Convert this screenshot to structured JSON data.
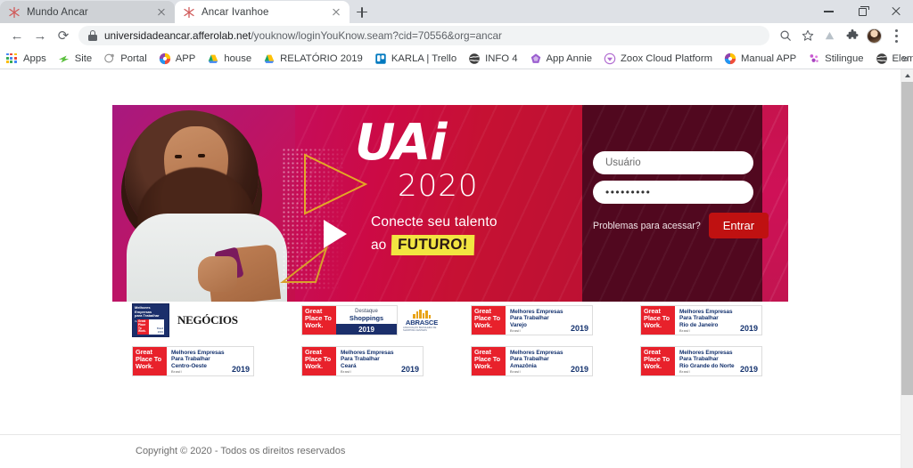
{
  "window": {
    "minimize_label": "Minimize",
    "maximize_label": "Maximize",
    "close_label": "Close"
  },
  "tabs": [
    {
      "title": "Mundo Ancar",
      "favicon": "ancar-star-icon",
      "active": false
    },
    {
      "title": "Ancar Ivanhoe",
      "favicon": "ancar-star-icon",
      "active": true
    }
  ],
  "new_tab_label": "+",
  "toolbar": {
    "back_label": "←",
    "forward_label": "→",
    "reload_label": "⟳",
    "url": "universidadeancar.afferolab.net",
    "url_path": "/youknow/loginYouKnow.seam?cid=70556&org=ancar",
    "security_icon": "lock-icon",
    "search_icon": "search-icon",
    "bookmark_icon": "star-icon",
    "drive_icon": "cloud-icon",
    "extensions_icon": "puzzle-icon",
    "profile_icon": "avatar-icon",
    "menu_icon": "three-dots-icon"
  },
  "bookmarks": {
    "items": [
      {
        "label": "Apps",
        "icon": "apps-grid-icon",
        "color": "#4285f4"
      },
      {
        "label": "Site",
        "icon": "site-icon",
        "color": "#5bbf3e"
      },
      {
        "label": "Portal",
        "icon": "portal-icon",
        "color": "#7a7a7a"
      },
      {
        "label": "APP",
        "icon": "app-icon",
        "color": "#ef4e3a"
      },
      {
        "label": "house",
        "icon": "google-drive-icon",
        "color": "#ffba00"
      },
      {
        "label": "RELATÓRIO 2019",
        "icon": "google-drive-icon",
        "color": "#ffba00"
      },
      {
        "label": "KARLA | Trello",
        "icon": "trello-icon",
        "color": "#0079bf"
      },
      {
        "label": "INFO 4",
        "icon": "globe-icon",
        "color": "#3d3d3d"
      },
      {
        "label": "App Annie",
        "icon": "app-annie-icon",
        "color": "#9b5fd0"
      },
      {
        "label": "Zoox Cloud Platform",
        "icon": "zoox-icon",
        "color": "#b06ad0"
      },
      {
        "label": "Manual APP",
        "icon": "app-icon",
        "color": "#ef4e3a"
      },
      {
        "label": "Stilingue",
        "icon": "stilingue-icon",
        "color": "#c85ad0"
      },
      {
        "label": "Elemídia",
        "icon": "globe-icon",
        "color": "#3d3d3d"
      }
    ],
    "overflow_label": "»"
  },
  "banner": {
    "logo": "UAi",
    "year": "2020",
    "tagline_line1": "Conecte seu talento",
    "tagline_prefix": "ao",
    "tagline_highlight": "FUTURO!",
    "accent_yellow": "#f2e541",
    "accent_gold": "#e3a825",
    "gradient_from": "#8e2a8c",
    "gradient_to": "#bd1133"
  },
  "login": {
    "username_placeholder": "Usuário",
    "username_value": "",
    "password_value": "•••••••••",
    "help_label": "Problemas para acessar?",
    "submit_label": "Entrar",
    "submit_color": "#bf1111",
    "panel_color": "#51081f"
  },
  "awards": {
    "rows": [
      [
        {
          "type": "negocios",
          "badge_line1": "Melhores",
          "badge_line2": "Empresas",
          "badge_line3": "para Trabalhar",
          "badge_sub": "Destaques",
          "inner_brand": "Great Place To Work.",
          "inner_brasil": "Brasil",
          "inner_year": "2019",
          "wordmark": "NEGÓCIOS"
        },
        {
          "type": "destaque",
          "gptw": "Great Place To Work.",
          "title_line1": "Destaque",
          "title_line2": "Shoppings",
          "year": "2019",
          "partner": "ABRASCE",
          "partner_sub": "ASSOCIAÇÃO BRASILEIRA DE SHOPPING CENTERS"
        },
        {
          "type": "gptw",
          "gptw": "Great Place To Work.",
          "line1": "Melhores Empresas",
          "line2": "Para Trabalhar",
          "line3": "Varejo",
          "brasil": "Brasil",
          "year": "2019"
        },
        {
          "type": "gptw",
          "gptw": "Great Place To Work.",
          "line1": "Melhores Empresas",
          "line2": "Para Trabalhar",
          "line3": "Rio de Janeiro",
          "brasil": "Brasil",
          "year": "2019"
        }
      ],
      [
        {
          "type": "gptw",
          "gptw": "Great Place To Work.",
          "line1": "Melhores Empresas",
          "line2": "Para Trabalhar",
          "line3": "Centro-Oeste",
          "brasil": "Brasil",
          "year": "2019"
        },
        {
          "type": "gptw",
          "gptw": "Great Place To Work.",
          "line1": "Melhores Empresas",
          "line2": "Para Trabalhar",
          "line3": "Ceará",
          "brasil": "Brasil",
          "year": "2019"
        },
        {
          "type": "gptw",
          "gptw": "Great Place To Work.",
          "line1": "Melhores Empresas",
          "line2": "Para Trabalhar",
          "line3": "Amazônia",
          "brasil": "Brasil",
          "year": "2019"
        },
        {
          "type": "gptw",
          "gptw": "Great Place To Work.",
          "line1": "Melhores Empresas",
          "line2": "Para Trabalhar",
          "line3": "Rio Grande do Norte",
          "brasil": "Brasil",
          "year": "2019"
        }
      ]
    ]
  },
  "footer": {
    "copyright": "Copyright © 2020 - Todos os direitos reservados"
  }
}
